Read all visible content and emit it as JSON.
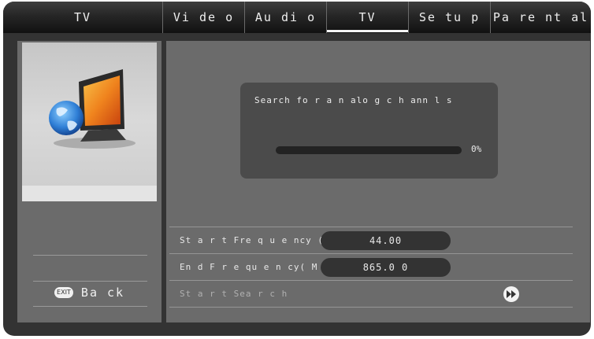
{
  "header": {
    "title": "TV",
    "tabs": [
      {
        "label": "Vi de o",
        "active": false
      },
      {
        "label": "Au di o",
        "active": false
      },
      {
        "label": "TV",
        "active": true
      },
      {
        "label": "Se tu p",
        "active": false
      },
      {
        "label": "Pa re nt al",
        "active": false
      }
    ]
  },
  "sidebar": {
    "image_icon": "tv-globe-icon",
    "exit_key_label": "EXIT",
    "back_label": "Ba ck"
  },
  "dialog": {
    "message": "Search fo r a n alo g c h ann l s",
    "progress": 0,
    "progress_text": "0%"
  },
  "settings": {
    "start_frequency": {
      "label": "St a r t Fre q u e ncy ( MHz )",
      "value": "44.00"
    },
    "end_frequency": {
      "label": "En d F r e qu e n cy( M H Z)",
      "value": "865.0 0"
    },
    "start_search": {
      "label": "St a r t Sea r c h",
      "icon": "fast-forward-icon"
    }
  },
  "colors": {
    "frame": "#333333",
    "panel": "#6b6b6b",
    "dialog": "#4b4b4b",
    "field": "#333333",
    "text": "#f0f0f0"
  }
}
